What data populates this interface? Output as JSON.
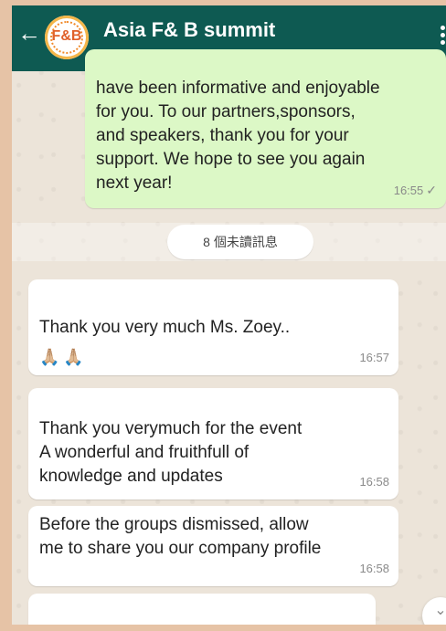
{
  "header": {
    "title": "Asia F& B summit",
    "avatar_text": "F&B",
    "back_glyph": "←"
  },
  "messages": [
    {
      "direction": "outgoing",
      "text": "have been informative and enjoyable\nfor you.  To our partners,sponsors,\nand speakers, thank you for your\nsupport.  We hope to see you again\nnext year!",
      "time": "16:55",
      "status_glyph": "✓"
    },
    {
      "direction": "incoming",
      "text": "Thank you very much Ms. Zoey..",
      "emoji": "🙏🏼🙏🏼",
      "time": "16:57"
    },
    {
      "direction": "incoming",
      "text": "Thank you verymuch for the event\nA wonderful and fruithfull of\nknowledge and updates",
      "time": "16:58"
    },
    {
      "direction": "incoming",
      "text": "Before the groups dismissed, allow\nme to share you our company profile",
      "time": "16:58"
    }
  ],
  "unread_label": "8 個未讀訊息",
  "colors": {
    "header": "#0e5a52",
    "outgoing_bubble": "#dcf8c6",
    "incoming_bubble": "#ffffff",
    "chat_background": "#ece4d9",
    "frame": "#e6c3a6"
  },
  "icons": {
    "back": "arrow-left-icon",
    "menu": "more-vertical-icon",
    "scroll": "chevron-down-icon"
  }
}
